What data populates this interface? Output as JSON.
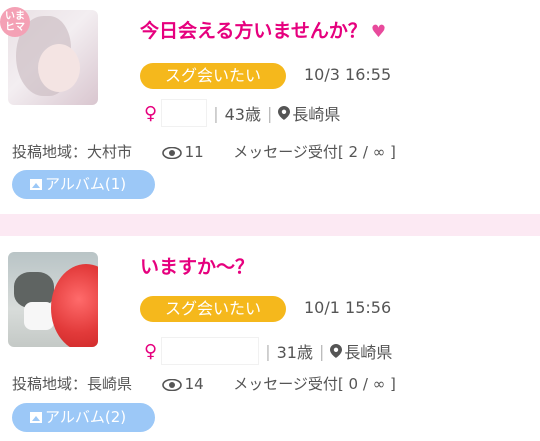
{
  "posts": [
    {
      "badge": "いま\nヒマ",
      "title": "今日会える方いませんか？",
      "title_icon": "heart-icon",
      "tag": "スグ会いたい",
      "datetime": "10/3 16:55",
      "gender_symbol": "♀",
      "age": "43歳",
      "location": "長崎県",
      "area": "投稿地域：大村市",
      "views": "11",
      "message": "メッセージ受付[ 2 / ∞ ]",
      "album": "アルバム(1)"
    },
    {
      "title": "いますか〜？",
      "tag": "スグ会いたい",
      "datetime": "10/1 15:56",
      "gender_symbol": "♀",
      "age": "31歳",
      "location": "長崎県",
      "area": "投稿地域：長崎県",
      "views": "14",
      "message": "メッセージ受付[ 0 / ∞ ]",
      "album": "アルバム(2)"
    }
  ],
  "colors": {
    "background": "#fce9f3",
    "title": "#e6007e",
    "tag": "#f5b81c",
    "album": "#9cc8f7"
  }
}
